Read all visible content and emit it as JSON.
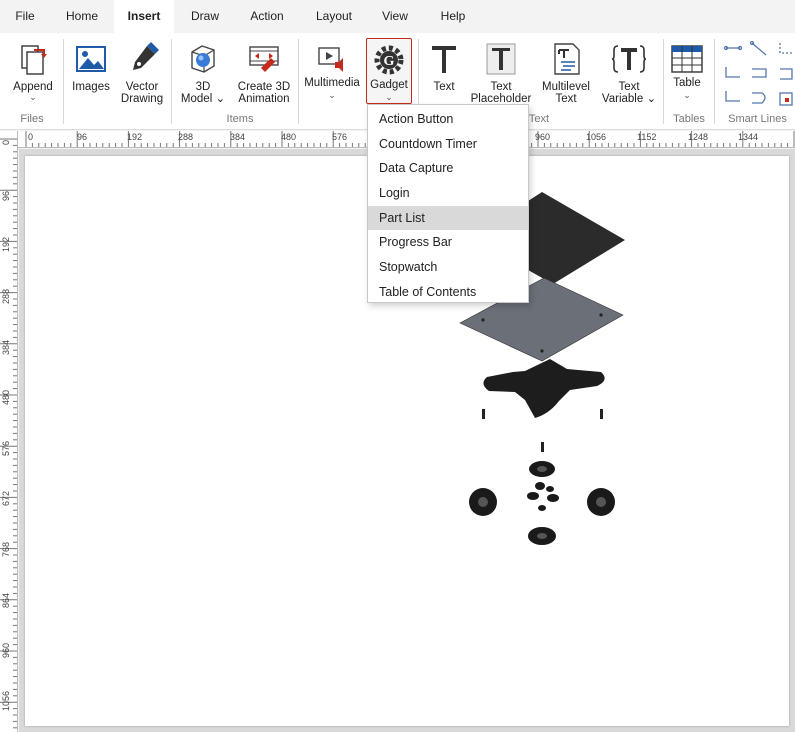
{
  "menu": {
    "tabs": [
      {
        "label": "File"
      },
      {
        "label": "Home"
      },
      {
        "label": "Insert",
        "active": true
      },
      {
        "label": "Draw"
      },
      {
        "label": "Action"
      },
      {
        "label": "Layout"
      },
      {
        "label": "View"
      },
      {
        "label": "Help"
      }
    ]
  },
  "ribbon": {
    "append": {
      "label": "Append",
      "chevron": "⌄"
    },
    "images": {
      "label": "Images"
    },
    "vector": {
      "label": "Vector\nDrawing"
    },
    "model3d": {
      "label": "3D\nModel ⌄"
    },
    "anim3d": {
      "label": "Create 3D\nAnimation"
    },
    "multimedia": {
      "label": "Multimedia",
      "chevron": "⌄"
    },
    "gadget": {
      "label": "Gadget",
      "chevron": "⌄"
    },
    "text": {
      "label": "Text"
    },
    "text_placeholder": {
      "label": "Text\nPlaceholder"
    },
    "multilevel": {
      "label": "Multilevel\nText"
    },
    "text_variable": {
      "label": "Text\nVariable ⌄"
    },
    "table": {
      "label": "Table",
      "chevron": "⌄"
    },
    "groups": {
      "files": "Files",
      "items": "Items",
      "text": "Text",
      "tables": "Tables",
      "smart_lines": "Smart Lines"
    }
  },
  "ruler": {
    "top": [
      "0",
      "96",
      "192",
      "288",
      "384",
      "480",
      "576",
      "960",
      "1056",
      "1152",
      "1248",
      "1344"
    ],
    "left": [
      "0",
      "96",
      "192",
      "288",
      "384",
      "480",
      "576",
      "672",
      "768",
      "864",
      "960",
      "1056"
    ]
  },
  "gadget_menu": {
    "items": [
      {
        "label": "Action Button"
      },
      {
        "label": "Countdown Timer"
      },
      {
        "label": "Data Capture"
      },
      {
        "label": "Login"
      },
      {
        "label": "Part List",
        "highlighted": true
      },
      {
        "label": "Progress Bar"
      },
      {
        "label": "Stopwatch"
      },
      {
        "label": "Table of Contents"
      }
    ]
  },
  "colors": {
    "accent_red": "#c42b1c",
    "icon_blue": "#1e5aa8",
    "highlight": "#d9d9d9"
  }
}
